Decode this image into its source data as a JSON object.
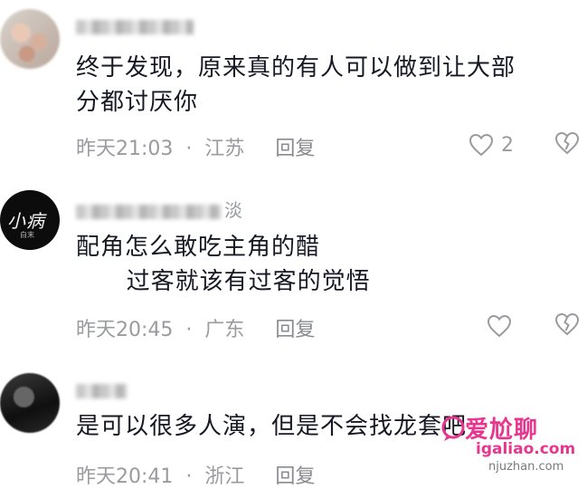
{
  "comments": [
    {
      "username_suffix": "",
      "text": "终于发现，原来真的有人可以做到让大部\n分都讨厌你",
      "time": "昨天21:03",
      "location": "江苏",
      "reply_label": "回复",
      "like_count": "2"
    },
    {
      "username_suffix": "淡",
      "text": "配角怎么敢吃主角的醋\n      过客就该有过客的觉悟",
      "time": "昨天20:45",
      "location": "广东",
      "reply_label": "回复",
      "like_count": ""
    },
    {
      "username_suffix": "",
      "text": "是可以很多人演，但是不会找龙套吧",
      "time": "昨天20:41",
      "location": "浙江",
      "reply_label": "回复",
      "like_count": ""
    }
  ],
  "avatar2": {
    "logo_text": "小病",
    "logo_sub": "白末"
  },
  "separator": "·",
  "watermark": {
    "title": "爱尬聊",
    "url": "igaliao.com",
    "url2": "njuzhan.com"
  },
  "colors": {
    "text": "#161823",
    "meta": "#9a9ba0",
    "watermark": "#e8368f"
  }
}
